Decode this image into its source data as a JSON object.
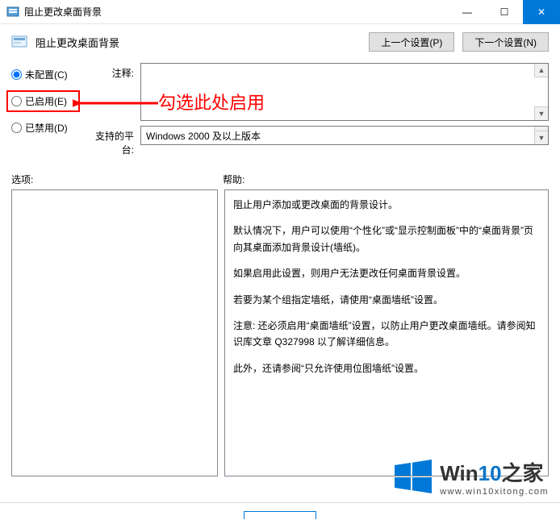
{
  "window": {
    "title": "阻止更改桌面背景",
    "minimize": "—",
    "maximize": "☐",
    "close": "✕"
  },
  "header": {
    "title": "阻止更改桌面背景",
    "prev_button": "上一个设置(P)",
    "next_button": "下一个设置(N)"
  },
  "radios": {
    "not_configured": "未配置(C)",
    "enabled": "已启用(E)",
    "disabled": "已禁用(D)"
  },
  "fields": {
    "comment_label": "注释:",
    "comment_value": "",
    "platform_label": "支持的平台:",
    "platform_value": "Windows 2000 及以上版本"
  },
  "annotation": {
    "text": "勾选此处启用"
  },
  "sections": {
    "options_label": "选项:",
    "help_label": "帮助:"
  },
  "help": {
    "p1": "阻止用户添加或更改桌面的背景设计。",
    "p2": "默认情况下，用户可以使用“个性化”或“显示控制面板”中的“桌面背景”页向其桌面添加背景设计(墙纸)。",
    "p3": "如果启用此设置，则用户无法更改任何桌面背景设置。",
    "p4": "若要为某个组指定墙纸，请使用“桌面墙纸”设置。",
    "p5": "注意: 还必须启用“桌面墙纸”设置，以防止用户更改桌面墙纸。请参阅知识库文章 Q327998 以了解详细信息。",
    "p6": "此外，还请参阅“只允许使用位图墙纸”设置。"
  },
  "watermark": {
    "brand_a": "Win",
    "brand_b": "10",
    "brand_c": "之家",
    "url": "www.win10xitong.com"
  }
}
